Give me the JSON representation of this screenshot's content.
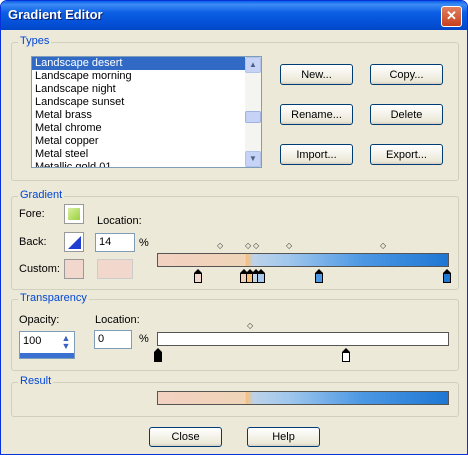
{
  "window": {
    "title": "Gradient Editor",
    "close_glyph": "✕"
  },
  "types": {
    "legend": "Types",
    "items": [
      "Landscape desert",
      "Landscape morning",
      "Landscape night",
      "Landscape sunset",
      "Metal brass",
      "Metal chrome",
      "Metal copper",
      "Metal steel",
      "Metallic gold 01"
    ],
    "selected_index": 0,
    "buttons": {
      "new": "New...",
      "copy": "Copy...",
      "rename": "Rename...",
      "delete": "Delete",
      "import": "Import...",
      "export": "Export..."
    }
  },
  "gradient": {
    "legend": "Gradient",
    "fore_label": "Fore:",
    "back_label": "Back:",
    "custom_label": "Custom:",
    "location_label": "Location:",
    "location_value": "14",
    "percent": "%",
    "colors": {
      "fore": "#b8e06a",
      "back": "#1f3fd0",
      "custom": "#f2d8cc"
    }
  },
  "transparency": {
    "legend": "Transparency",
    "opacity_label": "Opacity:",
    "opacity_value": "100",
    "location_label": "Location:",
    "location_value": "0",
    "percent": "%"
  },
  "result": {
    "legend": "Result"
  },
  "footer": {
    "close": "Close",
    "help": "Help"
  }
}
